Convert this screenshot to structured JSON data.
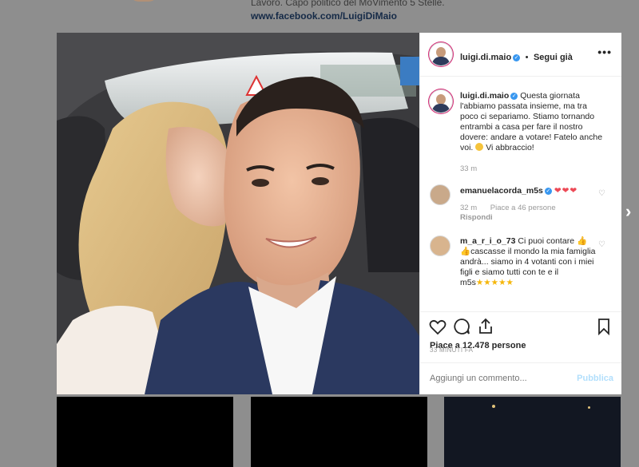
{
  "profile_bio": {
    "line": "Lavoro. Capo politico del MoVimento 5 Stelle.",
    "link": "www.facebook.com/LuigiDiMaio"
  },
  "post": {
    "username": "luigi.di.maio",
    "separator": "•",
    "follow_label": "Segui già",
    "more_icon": "more-options-icon",
    "caption": "Questa giornata l'abbiamo passata insieme, ma tra poco ci separiamo. Stiamo tornando entrambi a casa per fare il nostro dovere: andare a votare! Fatelo anche voi.",
    "caption_tail": "Vi abbraccio!",
    "caption_time": "33 m",
    "comments": [
      {
        "username": "emanuelacorda_m5s",
        "text": "",
        "hearts": "❤❤❤",
        "time": "32 m",
        "likes": "Piace a 46 persone",
        "reply": "Rispondi"
      },
      {
        "username": "m_a_r_i_o_73",
        "text1": "Ci puoi contare",
        "text2": "cascasse il mondo la mia famiglia andrà... siamo in 4 votanti con i miei figli e siamo tutti con te e il m5s",
        "stars": "★★★★★"
      }
    ],
    "likes_count": "Piace a 12.478 persone",
    "posted_time": "33 MINUTI FA",
    "comment_placeholder": "Aggiungi un commento...",
    "publish_label": "Pubblica"
  },
  "colors": {
    "verified": "#3897f0",
    "heart_red": "#ed4956",
    "publish_disabled": "#b2dffc",
    "star_gold": "#f5b60a"
  }
}
